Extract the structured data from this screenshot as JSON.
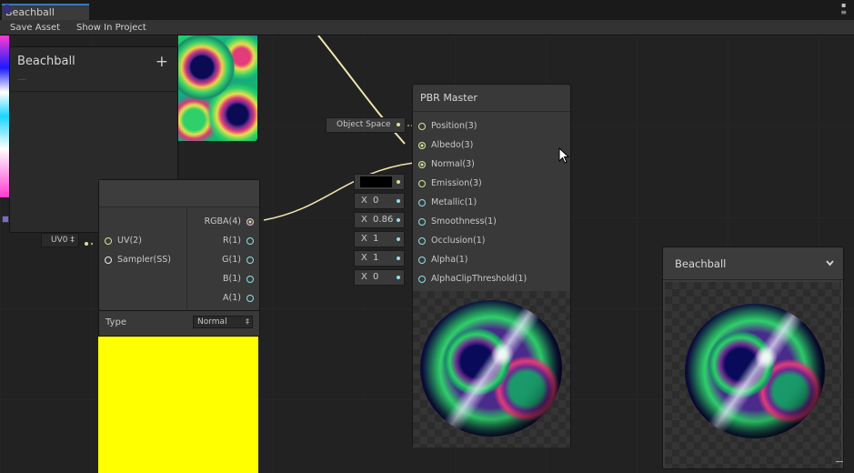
{
  "window": {
    "tab_title": "Beachball"
  },
  "toolbar": {
    "save_asset": "Save Asset",
    "show_in_project": "Show In Project"
  },
  "blackboard": {
    "title": "Beachball",
    "subtitle": "—",
    "add_symbol": "+"
  },
  "sample_node": {
    "inputs": [
      {
        "label": "UV(2)"
      },
      {
        "label": "Sampler(SS)"
      }
    ],
    "outputs": [
      {
        "label": "RGBA(4)"
      },
      {
        "label": "R(1)"
      },
      {
        "label": "G(1)"
      },
      {
        "label": "B(1)"
      },
      {
        "label": "A(1)"
      }
    ],
    "uv_value": "UV0 ‡",
    "type_label": "Type",
    "type_value": "Normal",
    "type_arrow": "‡",
    "preview_color": "#ffff00"
  },
  "pbr_master": {
    "title": "PBR Master",
    "ports": [
      {
        "label": "Position(3)"
      },
      {
        "label": "Albedo(3)"
      },
      {
        "label": "Normal(3)"
      },
      {
        "label": "Emission(3)"
      },
      {
        "label": "Metallic(1)"
      },
      {
        "label": "Smoothness(1)"
      },
      {
        "label": "Occlusion(1)"
      },
      {
        "label": "Alpha(1)"
      },
      {
        "label": "AlphaClipThreshold(1)"
      }
    ],
    "position_space": "Object Space",
    "emission_color": "#000000",
    "fields": {
      "metallic": {
        "axis": "X",
        "value": "0"
      },
      "smoothness": {
        "axis": "X",
        "value": "0.86"
      },
      "occlusion": {
        "axis": "X",
        "value": "1"
      },
      "alpha": {
        "axis": "X",
        "value": "1"
      },
      "alpha_clip": {
        "axis": "X",
        "value": "0"
      }
    }
  },
  "main_preview": {
    "title": "Beachball",
    "dropdown_icon": "chevron-down-icon"
  },
  "colors": {
    "accent": "#3a79bb",
    "vector_port": "#cfe89a",
    "float_port": "#8fe0e6",
    "color_port": "#f3c0e0"
  }
}
